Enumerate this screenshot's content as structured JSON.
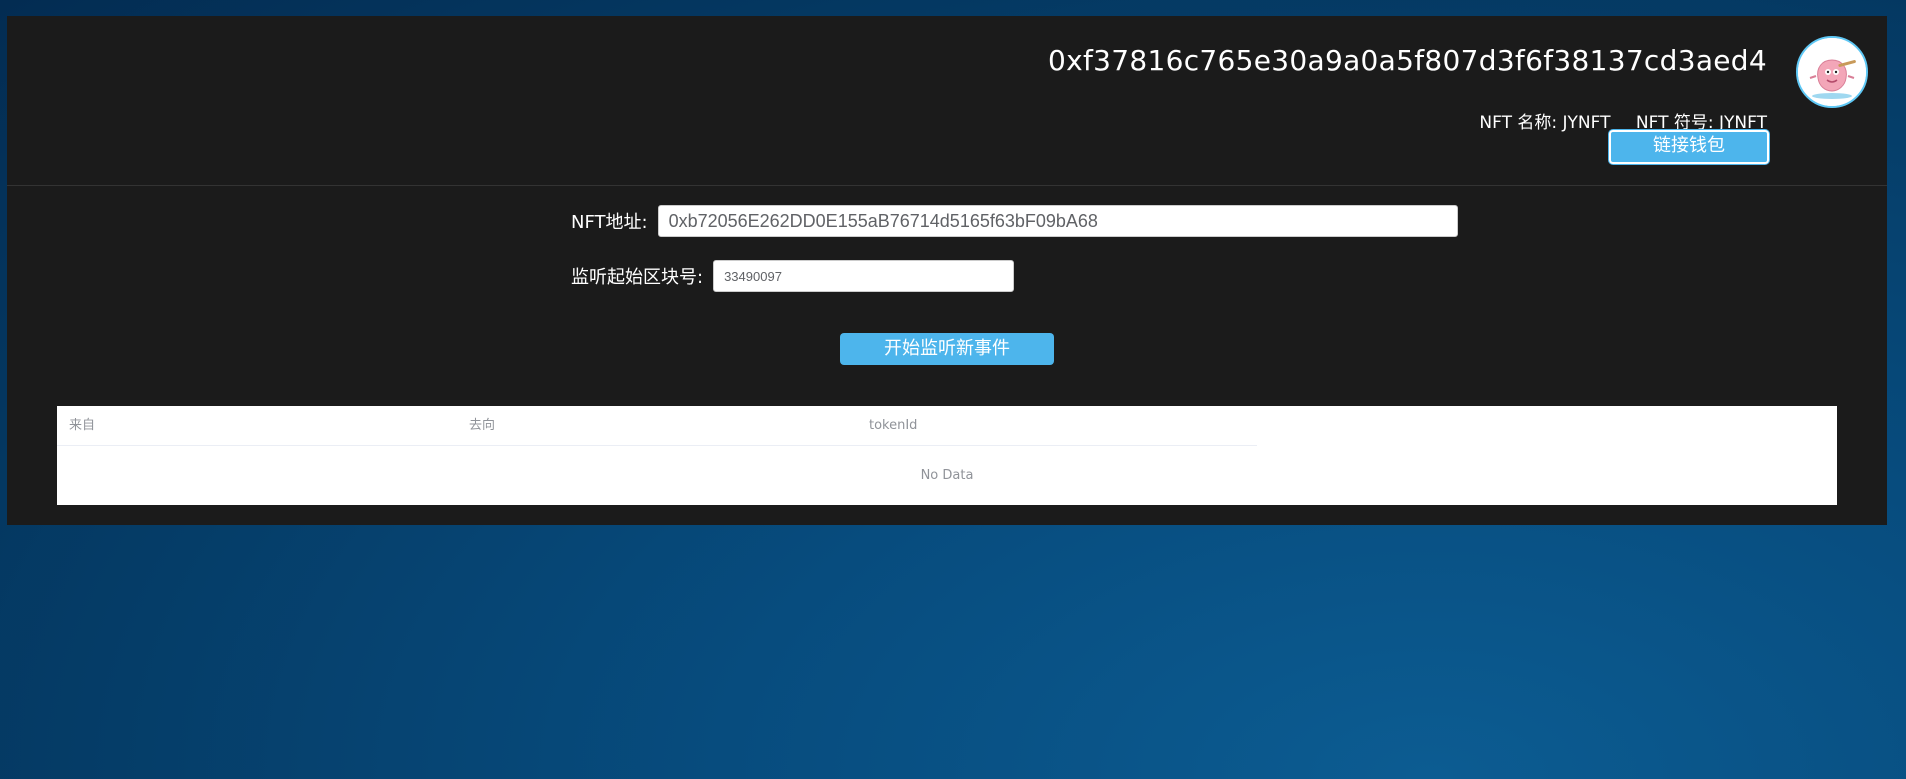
{
  "header": {
    "account_address": "0xf37816c765e30a9a0a5f807d3f6f38137cd3aed4",
    "nft_name_label": "NFT 名称: JYNFT",
    "nft_symbol_label": "NFT 符号: JYNFT",
    "connect_wallet_label": "链接钱包",
    "avatar_icon": "patrick-star-avatar-icon"
  },
  "form": {
    "nft_address_label": "NFT地址:",
    "nft_address_value": "0xb72056E262DD0E155aB76714d5165f63bF09bA68",
    "start_block_label": "监听起始区块号:",
    "start_block_value": "33490097",
    "start_button_label": "开始监听新事件"
  },
  "table": {
    "columns": [
      "来自",
      "去向",
      "tokenId"
    ],
    "empty_text": "No Data"
  },
  "colors": {
    "accent": "#4db5ec",
    "panel_bg": "#1b1b1b",
    "page_bg": "#053d68"
  }
}
